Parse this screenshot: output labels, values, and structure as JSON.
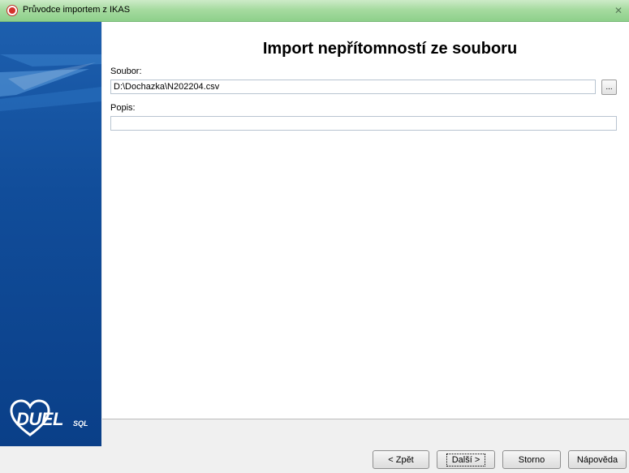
{
  "window": {
    "title": "Průvodce importem z IKAS"
  },
  "sidebar": {
    "logo_text": "DUEL",
    "logo_sub": "SQL"
  },
  "content": {
    "heading": "Import nepřítomností ze souboru",
    "file": {
      "label": "Soubor:",
      "value": "D:\\Dochazka\\N202204.csv",
      "browse_label": "..."
    },
    "description": {
      "label": "Popis:",
      "value": ""
    }
  },
  "buttons": {
    "back": "< Zpět",
    "next": "Další >",
    "cancel": "Storno",
    "help": "Nápověda"
  },
  "colors": {
    "titlebar": "#a6dba0",
    "sidebar": "#114d9a"
  }
}
